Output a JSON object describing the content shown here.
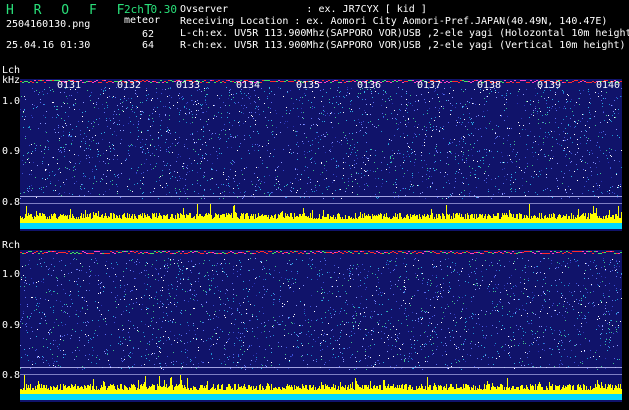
{
  "header": {
    "app_name": "H R O F F T",
    "version": "2ch 0.30",
    "filename": "2504160130.png",
    "meteor_label": "meteor",
    "meteor_lch": "62",
    "meteor_rch": "64",
    "datetime": "25.04.16 01:30",
    "observer": "Ovserver             : ex. JR7CYX [ kid ]",
    "location": "Receiving Location : ex. Aomori City Aomori-Pref.JAPAN(40.49N, 140.47E)",
    "lch_info": "L-ch:ex. UV5R 113.900Mhz(SAPPORO VOR)USB ,2-ele yagi (Holozontal 10m height)",
    "rch_info": "R-ch:ex. UV5R 113.900Mhz(SAPPORO VOR)USB ,2-ele yagi (Vertical 10m height)"
  },
  "lch": {
    "channel_label": "Lch",
    "unit_label": "kHz",
    "y_ticks": [
      "1.0",
      "0.9",
      "0.8"
    ],
    "time_ticks": [
      "0131",
      "0132",
      "0133",
      "0134",
      "0135",
      "0136",
      "0137",
      "0138",
      "0139",
      "0140"
    ]
  },
  "rch": {
    "channel_label": "Rch",
    "y_ticks": [
      "1.0",
      "0.9",
      "0.8"
    ]
  },
  "colors": {
    "background": "#000000",
    "waterfall_bg": "#10136a",
    "app_green": "#29e07a",
    "signal_yellow": "#ffff00",
    "baseline_cyan": "#00d8ff",
    "top_band_red": "#ff2a2a"
  }
}
